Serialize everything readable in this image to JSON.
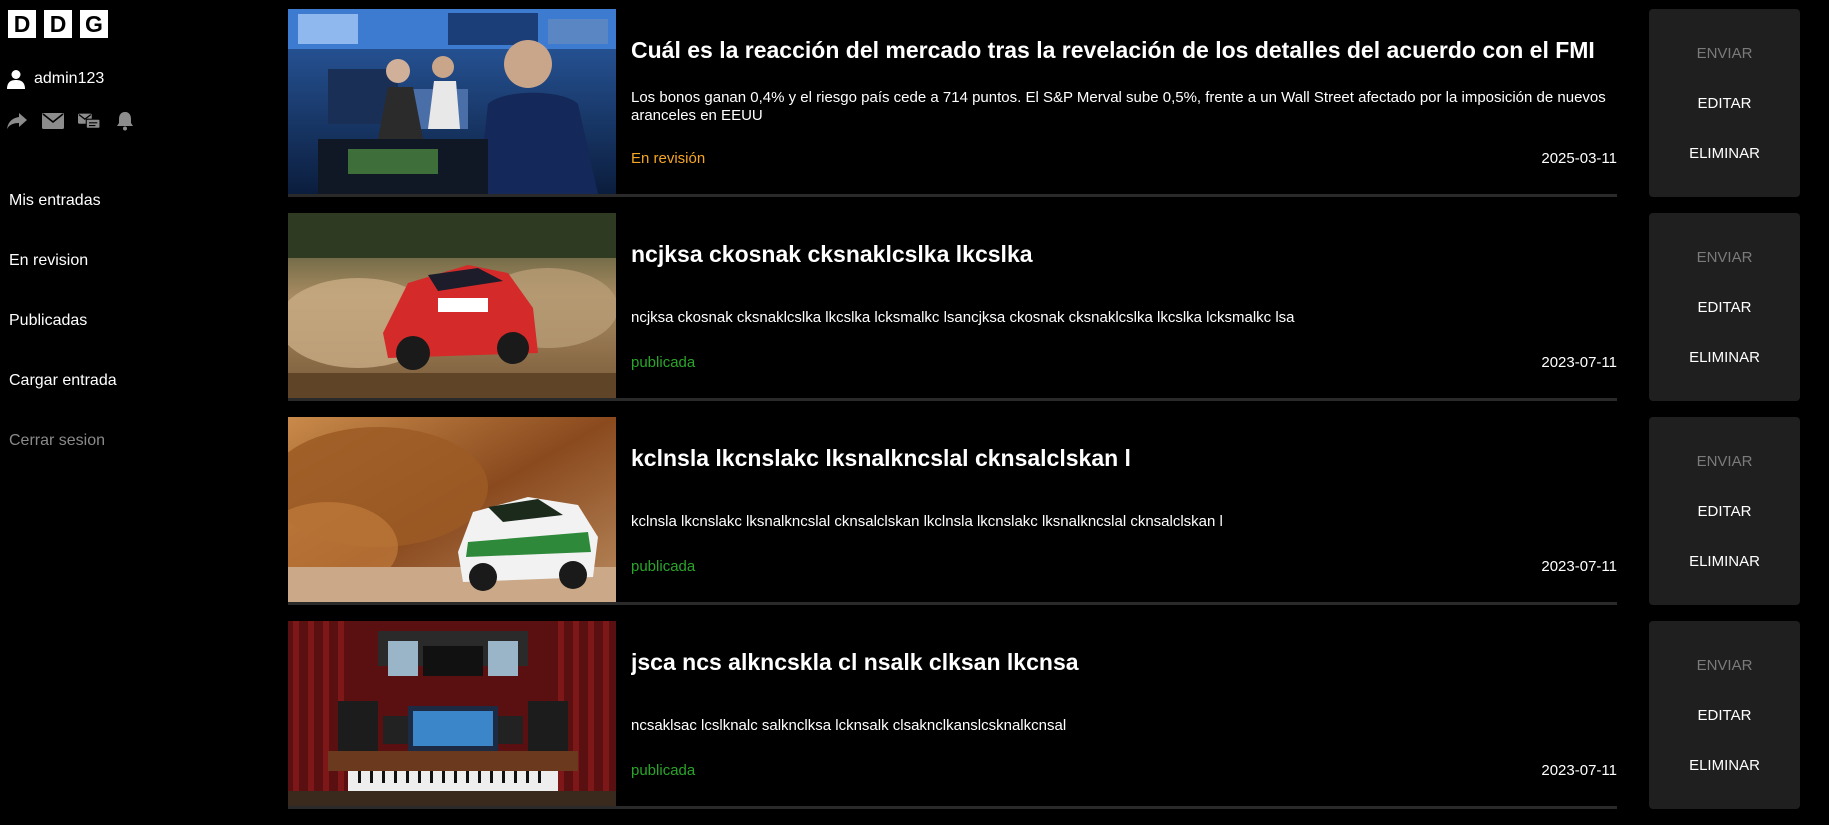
{
  "sidebar": {
    "logo_letters": [
      "D",
      "D",
      "G"
    ],
    "username": "admin123",
    "icons": [
      "share-icon",
      "mail-icon",
      "messages-icon",
      "bell-icon"
    ],
    "nav": [
      {
        "label": "Mis entradas"
      },
      {
        "label": "En revision"
      },
      {
        "label": "Publicadas"
      },
      {
        "label": "Cargar entrada"
      },
      {
        "label": "Cerrar sesion"
      }
    ]
  },
  "colors": {
    "background": "#000000",
    "status_review": "#f5a623",
    "status_published": "#2aa52a",
    "actions_panel": "#1f1f1f",
    "disabled_text": "#7a7a7a"
  },
  "actions": {
    "send": "ENVIAR",
    "edit": "EDITAR",
    "delete": "ELIMINAR"
  },
  "entries": [
    {
      "title": "Cuál es la reacción del mercado tras la revelación de los detalles del acuerdo con el FMI",
      "description": "Los bonos ganan 0,4% y el riesgo país cede a 714 puntos. El S&P Merval sube 0,5%, frente a un Wall Street afectado por la imposición de nuevos aranceles en EEUU",
      "status": "En revisión",
      "status_type": "review",
      "date": "2025-03-11",
      "image": "stock-exchange-traders"
    },
    {
      "title": "ncjksa ckosnak cksnaklcslka lkcslka",
      "description": "ncjksa ckosnak cksnaklcslka lkcslka lcksmalkc lsancjksa ckosnak cksnaklcslka lkcslka lcksmalkc lsa",
      "status": "publicada",
      "status_type": "published",
      "date": "2023-07-11",
      "image": "red-rally-car"
    },
    {
      "title": "kclnsla lkcnslakc lksnalkncslal cknsalclskan l",
      "description": "kclnsla lkcnslakc lksnalkncslal cknsalclskan lkclnsla lkcnslakc lksnalkncslal cknsalclskan l",
      "status": "publicada",
      "status_type": "published",
      "date": "2023-07-11",
      "image": "green-rally-car"
    },
    {
      "title": "jsca ncs alkncskla cl nsalk clksan lkcnsa",
      "description": "ncsaklsac lcslknalc salknclksa lcknsalk clsaknclkanslcsknalkcnsal",
      "status": "publicada",
      "status_type": "published",
      "date": "2023-07-11",
      "image": "music-studio"
    }
  ]
}
